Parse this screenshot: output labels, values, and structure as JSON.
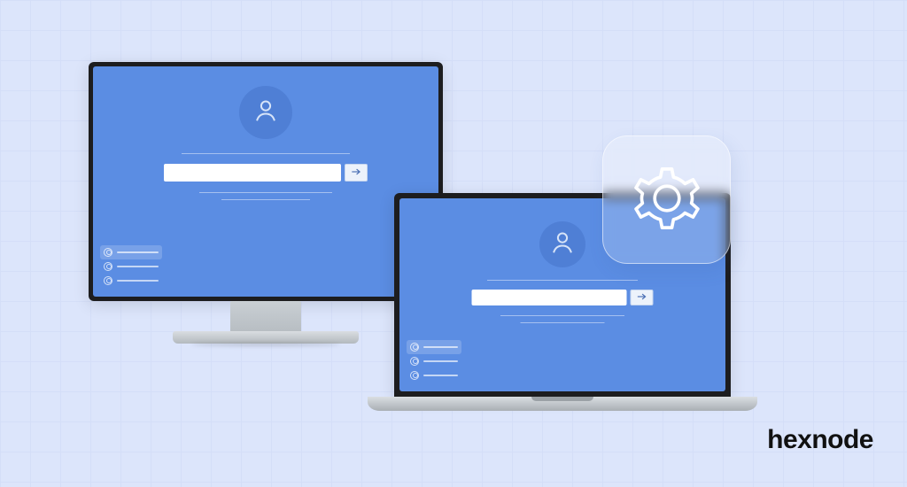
{
  "brand": "hexnode",
  "desktop": {
    "avatar_icon": "user-icon",
    "password_value": "",
    "password_placeholder": "",
    "submit_icon": "arrow-right-icon",
    "users": [
      {
        "selected": true
      },
      {
        "selected": false
      },
      {
        "selected": false
      }
    ]
  },
  "laptop": {
    "avatar_icon": "user-icon",
    "password_value": "",
    "password_placeholder": "",
    "submit_icon": "arrow-right-icon",
    "users": [
      {
        "selected": true
      },
      {
        "selected": false
      },
      {
        "selected": false
      }
    ]
  },
  "settings_tile": {
    "icon": "gear-icon"
  },
  "colors": {
    "background": "#dce5fb",
    "screen": "#5b8de3",
    "avatar_circle": "#4f7fd5"
  }
}
